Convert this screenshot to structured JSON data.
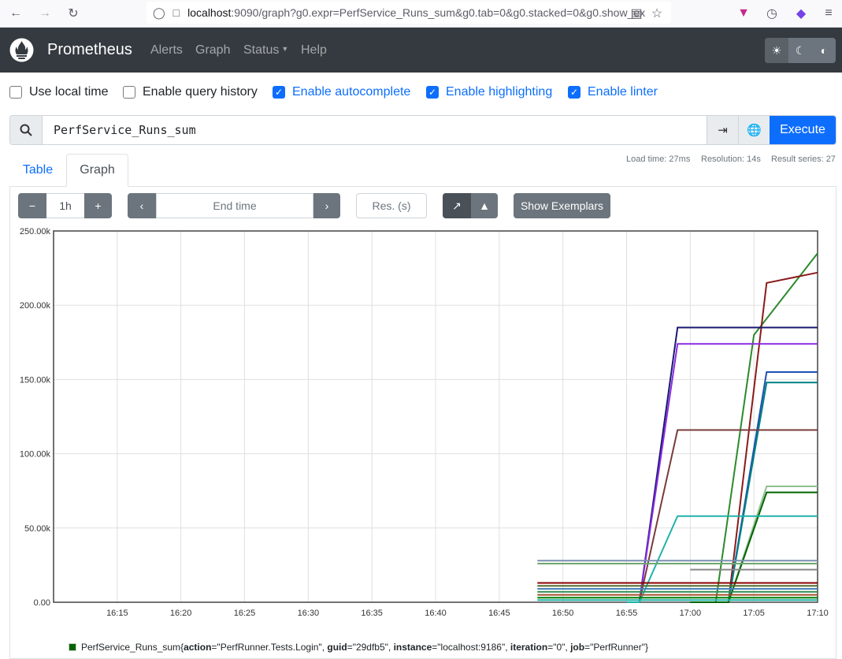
{
  "browser": {
    "url_host": "localhost",
    "url_rest": ":9090/graph?g0.expr=PerfService_Runs_sum&g0.tab=0&g0.stacked=0&g0.show_ex"
  },
  "nav": {
    "brand": "Prometheus",
    "links": [
      "Alerts",
      "Graph",
      "Status",
      "Help"
    ]
  },
  "options": [
    {
      "label": "Use local time",
      "checked": false
    },
    {
      "label": "Enable query history",
      "checked": false
    },
    {
      "label": "Enable autocomplete",
      "checked": true
    },
    {
      "label": "Enable highlighting",
      "checked": true
    },
    {
      "label": "Enable linter",
      "checked": true
    }
  ],
  "query": {
    "expression": "PerfService_Runs_sum",
    "execute_label": "Execute"
  },
  "stats": {
    "load_time": "Load time: 27ms",
    "resolution": "Resolution: 14s",
    "result_series": "Result series: 27"
  },
  "tabs": {
    "table": "Table",
    "graph": "Graph"
  },
  "controls": {
    "range": "1h",
    "end_time_placeholder": "End time",
    "res_placeholder": "Res. (s)",
    "show_exemplars": "Show Exemplars"
  },
  "chart_data": {
    "type": "line",
    "x_ticks": [
      "16:15",
      "16:20",
      "16:25",
      "16:30",
      "16:35",
      "16:40",
      "16:45",
      "16:50",
      "16:55",
      "17:00",
      "17:05",
      "17:10"
    ],
    "y_ticks": [
      "0.00",
      "50.00k",
      "100.00k",
      "150.00k",
      "200.00k",
      "250.00k"
    ],
    "ylim": [
      0,
      250000
    ],
    "xlim_minutes": [
      0,
      60
    ],
    "grid": true,
    "series": [
      {
        "color": "#2b8a2b",
        "points": [
          [
            50,
            0
          ],
          [
            52,
            0
          ],
          [
            55,
            180000
          ],
          [
            60,
            235000
          ]
        ]
      },
      {
        "color": "#8b1a1a",
        "points": [
          [
            50,
            0
          ],
          [
            53,
            0
          ],
          [
            56,
            215000
          ],
          [
            60,
            222000
          ]
        ]
      },
      {
        "color": "#191970",
        "points": [
          [
            45,
            0
          ],
          [
            46,
            0
          ],
          [
            49,
            185000
          ],
          [
            60,
            185000
          ]
        ]
      },
      {
        "color": "#8a2be2",
        "points": [
          [
            45,
            0
          ],
          [
            46,
            0
          ],
          [
            49,
            174000
          ],
          [
            60,
            174000
          ]
        ]
      },
      {
        "color": "#1e50b4",
        "points": [
          [
            50,
            0
          ],
          [
            53,
            0
          ],
          [
            56,
            155000
          ],
          [
            60,
            155000
          ]
        ]
      },
      {
        "color": "#008080",
        "points": [
          [
            50,
            0
          ],
          [
            53,
            0
          ],
          [
            56,
            148000
          ],
          [
            60,
            148000
          ]
        ]
      },
      {
        "color": "#7b3b3b",
        "points": [
          [
            45,
            0
          ],
          [
            46,
            0
          ],
          [
            49,
            116000
          ],
          [
            60,
            116000
          ]
        ]
      },
      {
        "color": "#90c090",
        "points": [
          [
            50,
            0
          ],
          [
            53,
            0
          ],
          [
            56,
            78000
          ],
          [
            60,
            78000
          ]
        ]
      },
      {
        "color": "#006400",
        "points": [
          [
            50,
            0
          ],
          [
            53,
            0
          ],
          [
            56,
            74000
          ],
          [
            60,
            74000
          ]
        ]
      },
      {
        "color": "#20b2aa",
        "points": [
          [
            45,
            0
          ],
          [
            46,
            0
          ],
          [
            49,
            58000
          ],
          [
            60,
            58000
          ]
        ]
      },
      {
        "color": "#7a8fb0",
        "points": [
          [
            38,
            28000
          ],
          [
            60,
            28000
          ]
        ]
      },
      {
        "color": "#6fa86f",
        "points": [
          [
            38,
            26000
          ],
          [
            60,
            26000
          ]
        ]
      },
      {
        "color": "#888888",
        "points": [
          [
            50,
            22000
          ],
          [
            60,
            22000
          ]
        ]
      },
      {
        "color": "#8b0000",
        "points": [
          [
            38,
            13000
          ],
          [
            60,
            13000
          ]
        ]
      },
      {
        "color": "#556b2f",
        "points": [
          [
            38,
            11000
          ],
          [
            60,
            11000
          ]
        ]
      },
      {
        "color": "#4682b4",
        "points": [
          [
            38,
            9000
          ],
          [
            60,
            9000
          ]
        ]
      },
      {
        "color": "#2e8b57",
        "points": [
          [
            38,
            7000
          ],
          [
            60,
            7000
          ]
        ]
      },
      {
        "color": "#a0522d",
        "points": [
          [
            38,
            5000
          ],
          [
            60,
            5000
          ]
        ]
      },
      {
        "color": "#008000",
        "points": [
          [
            38,
            3000
          ],
          [
            60,
            3000
          ]
        ]
      },
      {
        "color": "#20b2aa",
        "points": [
          [
            38,
            1500
          ],
          [
            60,
            1500
          ]
        ]
      }
    ],
    "legend": {
      "color": "#006400",
      "metric": "PerfService_Runs_sum",
      "labels": [
        {
          "key": "action",
          "value": "\"PerfRunner.Tests.Login\""
        },
        {
          "key": "guid",
          "value": "\"29dfb5\""
        },
        {
          "key": "instance",
          "value": "\"localhost:9186\""
        },
        {
          "key": "iteration",
          "value": "\"0\""
        },
        {
          "key": "job",
          "value": "\"PerfRunner\""
        }
      ]
    }
  }
}
